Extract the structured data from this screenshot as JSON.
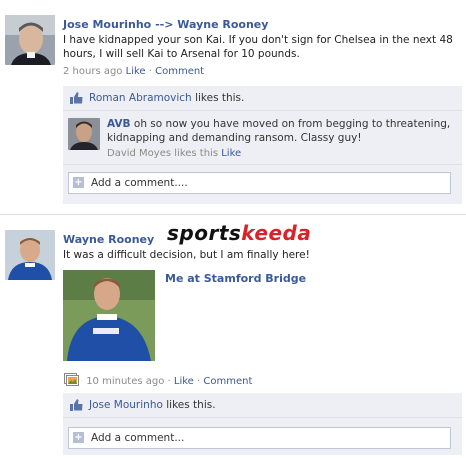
{
  "post1": {
    "author": "Jose Mourinho --> Wayne Rooney",
    "text": "I have kidnapped your son Kai. If you don't sign for Chelsea in the next 48 hours, I will sell Kai to Arsenal for 10 pounds.",
    "time": "2 hours ago",
    "like_link": "Like",
    "comment_link": "Comment",
    "likes": {
      "name": "Roman Abramovich",
      "suffix": "likes this."
    },
    "comment": {
      "author": "AVB",
      "text": "oh so now you have moved on from begging to threatening, kidnapping and demanding ransom. Classy guy!",
      "likes_text": "David Moyes likes this",
      "like_link": "Like"
    },
    "add_comment_placeholder": "Add a comment...."
  },
  "post2": {
    "author": "Wayne Rooney",
    "logo_part1": "sports",
    "logo_part2": "keeda",
    "text": "It was a difficult decision, but I am finally here!",
    "photo_caption": "Me at Stamford Bridge",
    "time": "10 minutes ago",
    "like_link": "Like",
    "comment_link": "Comment",
    "likes": {
      "name": "Jose Mourinho",
      "suffix": "likes this."
    },
    "add_comment_placeholder": "Add a comment..."
  },
  "colors": {
    "link": "#3b5998",
    "panel": "#edeff4",
    "logo_black": "#111111",
    "logo_red": "#d8232a"
  },
  "icons": [
    "thumbs-up-icon",
    "plus-icon",
    "photo-album-icon"
  ]
}
